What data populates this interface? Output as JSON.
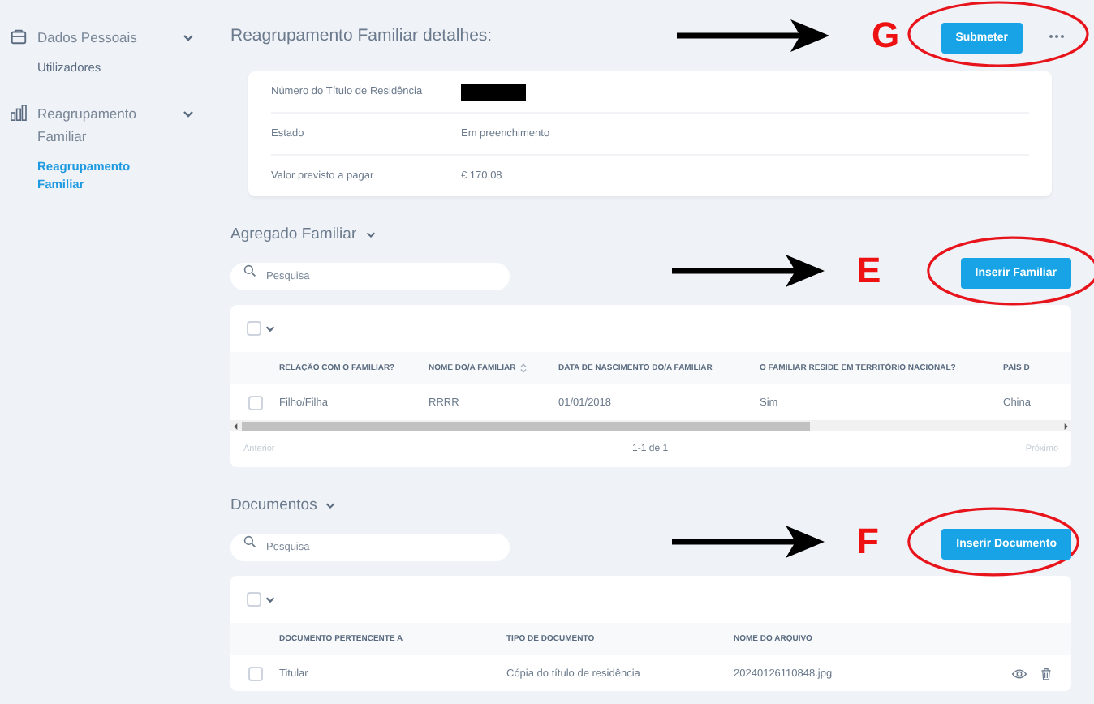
{
  "sidebar": {
    "groups": [
      {
        "kind": "case",
        "label": "Dados Pessoais",
        "expanded": true,
        "items": [
          {
            "label": "Utilizadores",
            "selected": false
          }
        ]
      },
      {
        "kind": "chart",
        "label": "Reagrupamento Familiar",
        "expanded": true,
        "items": [
          {
            "label": "Reagrupamento Familiar",
            "selected": true
          }
        ]
      }
    ]
  },
  "details": {
    "title": "Reagrupamento Familiar detalhes:",
    "button": "Submeter",
    "annotation": {
      "letter": "G"
    },
    "rows": [
      {
        "label": "Número do Título de Residência",
        "redacted": true
      },
      {
        "label": "Estado",
        "value": "Em preenchimento"
      },
      {
        "label": "Valor previsto a pagar",
        "value": "€ 170,08"
      }
    ]
  },
  "sections": [
    {
      "title": "Agregado Familiar",
      "search_placeholder": "Pesquisa",
      "select_all": {
        "checked": false
      },
      "button": "Inserir Familiar",
      "annotation": {
        "letter": "E"
      },
      "scrollbar": true,
      "columns": [
        {
          "label": "RELAÇÃO COM O FAMILIAR?",
          "sortable": false
        },
        {
          "label": "NOME DO/A FAMILIAR",
          "sortable": true
        },
        {
          "label": "DATA DE NASCIMENTO DO/A FAMILIAR",
          "sortable": false
        },
        {
          "label": "O FAMILIAR RESIDE EM TERRITÓRIO NACIONAL?",
          "sortable": false
        },
        {
          "label": "PAÍS D",
          "sortable": false
        }
      ],
      "rows": [
        {
          "checked": false,
          "cells": [
            "Filho/Filha",
            "RRRR",
            "01/01/2018",
            "Sim",
            "China"
          ],
          "actions": false
        }
      ],
      "pagination": {
        "previous": {
          "label": "Anterior",
          "disabled": true
        },
        "range": "1-1 de 1",
        "next": {
          "label": "Próximo",
          "disabled": true
        }
      }
    },
    {
      "title": "Documentos",
      "search_placeholder": "Pesquisa",
      "select_all": {
        "checked": false
      },
      "button": "Inserir Documento",
      "annotation": {
        "letter": "F"
      },
      "scrollbar": false,
      "columns": [
        {
          "label": "DOCUMENTO PERTENCENTE A",
          "sortable": false
        },
        {
          "label": "TIPO DE DOCUMENTO",
          "sortable": false
        },
        {
          "label": "NOME DO ARQUIVO",
          "sortable": false
        }
      ],
      "rows": [
        {
          "checked": false,
          "cells": [
            "Titular",
            "Cópia do título de residência",
            "20240126110848.jpg"
          ],
          "actions": true
        }
      ]
    }
  ]
}
